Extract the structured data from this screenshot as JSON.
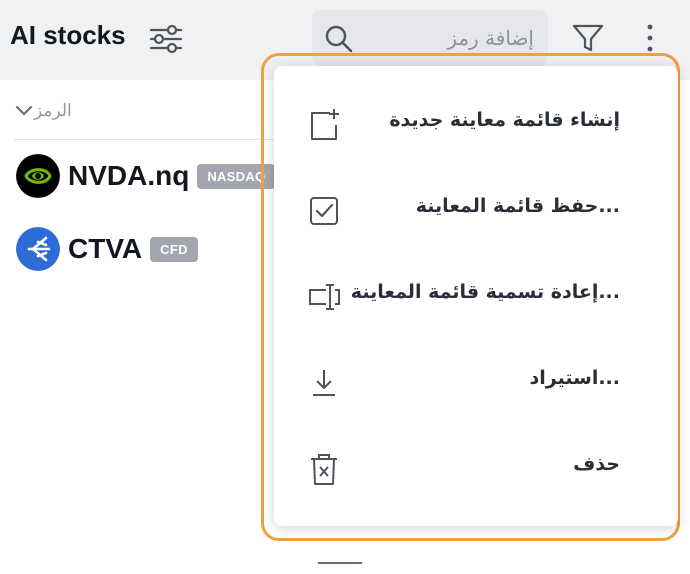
{
  "watchlist": {
    "title": "AI stocks"
  },
  "search": {
    "placeholder": "إضافة رمز",
    "value": ""
  },
  "column_header": {
    "label": "الرمز"
  },
  "symbols": [
    {
      "ticker": "NVDA.nq",
      "badge": "NASDAQ",
      "logo_color": "#000000",
      "logo_accent": "#76b900"
    },
    {
      "ticker": "CTVA",
      "badge": "CFD",
      "logo_color": "#2e6bd6"
    }
  ],
  "menu": {
    "items": [
      {
        "label": "إنشاء قائمة معاينة جديدة",
        "icon": "add-list-icon"
      },
      {
        "label": "...حفظ قائمة المعاينة",
        "icon": "checkbox-icon"
      },
      {
        "label": "...إعادة تسمية قائمة المعاينة",
        "icon": "rename-icon"
      },
      {
        "label": "...استيراد",
        "icon": "download-icon"
      },
      {
        "label": "حذف",
        "icon": "trash-icon"
      }
    ]
  },
  "colors": {
    "highlight_outline": "#f0a040",
    "badge_bg": "#a3a6af"
  }
}
